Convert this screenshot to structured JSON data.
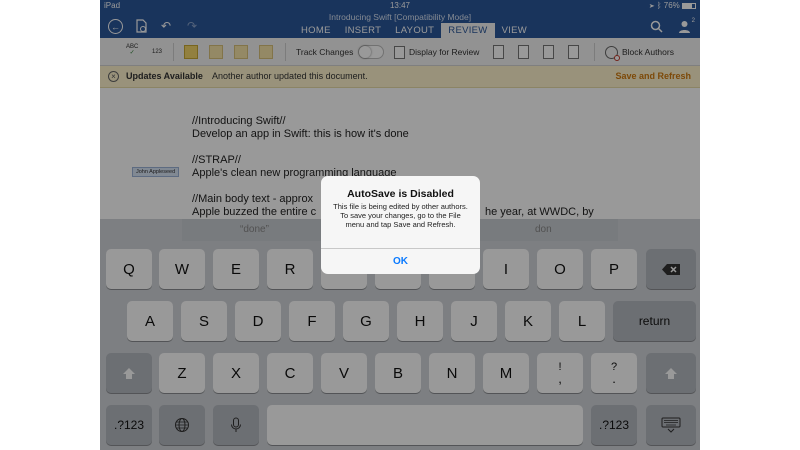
{
  "status_bar": {
    "device": "iPad",
    "time": "13:47",
    "battery": "76%"
  },
  "header": {
    "doc_title": "Introducing Swift [Compatibility Mode]",
    "tabs": [
      "HOME",
      "INSERT",
      "LAYOUT",
      "REVIEW",
      "VIEW"
    ],
    "active_tab": "REVIEW",
    "share_count": "2"
  },
  "toolbar": {
    "track_changes_label": "Track Changes",
    "track_changes_on": false,
    "display_for_review_label": "Display for Review",
    "block_authors_label": "Block Authors"
  },
  "notification": {
    "title": "Updates Available",
    "message": "Another author updated this document.",
    "action": "Save and Refresh"
  },
  "document": {
    "lines": [
      "//Introducing Swift//",
      "Develop an app in Swift: this is how it's done",
      "//STRAP//",
      "Apple's clean new programming language",
      "//Main body text - approx",
      "Apple buzzed the entire c"
    ],
    "line_right": "he year, at WWDC, by",
    "author_tag": "John Appleseed"
  },
  "keyboard": {
    "predictions": [
      "“done”",
      "don"
    ],
    "row1": [
      "Q",
      "W",
      "E",
      "R",
      "T",
      "Y",
      "U",
      "I",
      "O",
      "P"
    ],
    "row2": [
      "A",
      "S",
      "D",
      "F",
      "G",
      "H",
      "J",
      "K",
      "L"
    ],
    "row3": [
      "Z",
      "X",
      "C",
      "V",
      "B",
      "N",
      "M"
    ],
    "exclaim": [
      "!",
      ","
    ],
    "question": [
      "?",
      "."
    ],
    "return_label": "return",
    "numbers_label": ".?123"
  },
  "alert": {
    "title": "AutoSave is Disabled",
    "message": "This file is being edited by other authors. To save your changes, go to the File menu and tap Save and Refresh.",
    "ok_label": "OK"
  },
  "colors": {
    "ribbon": "#2b579a",
    "accent": "#0a7aff",
    "notice": "#fff4ce"
  }
}
